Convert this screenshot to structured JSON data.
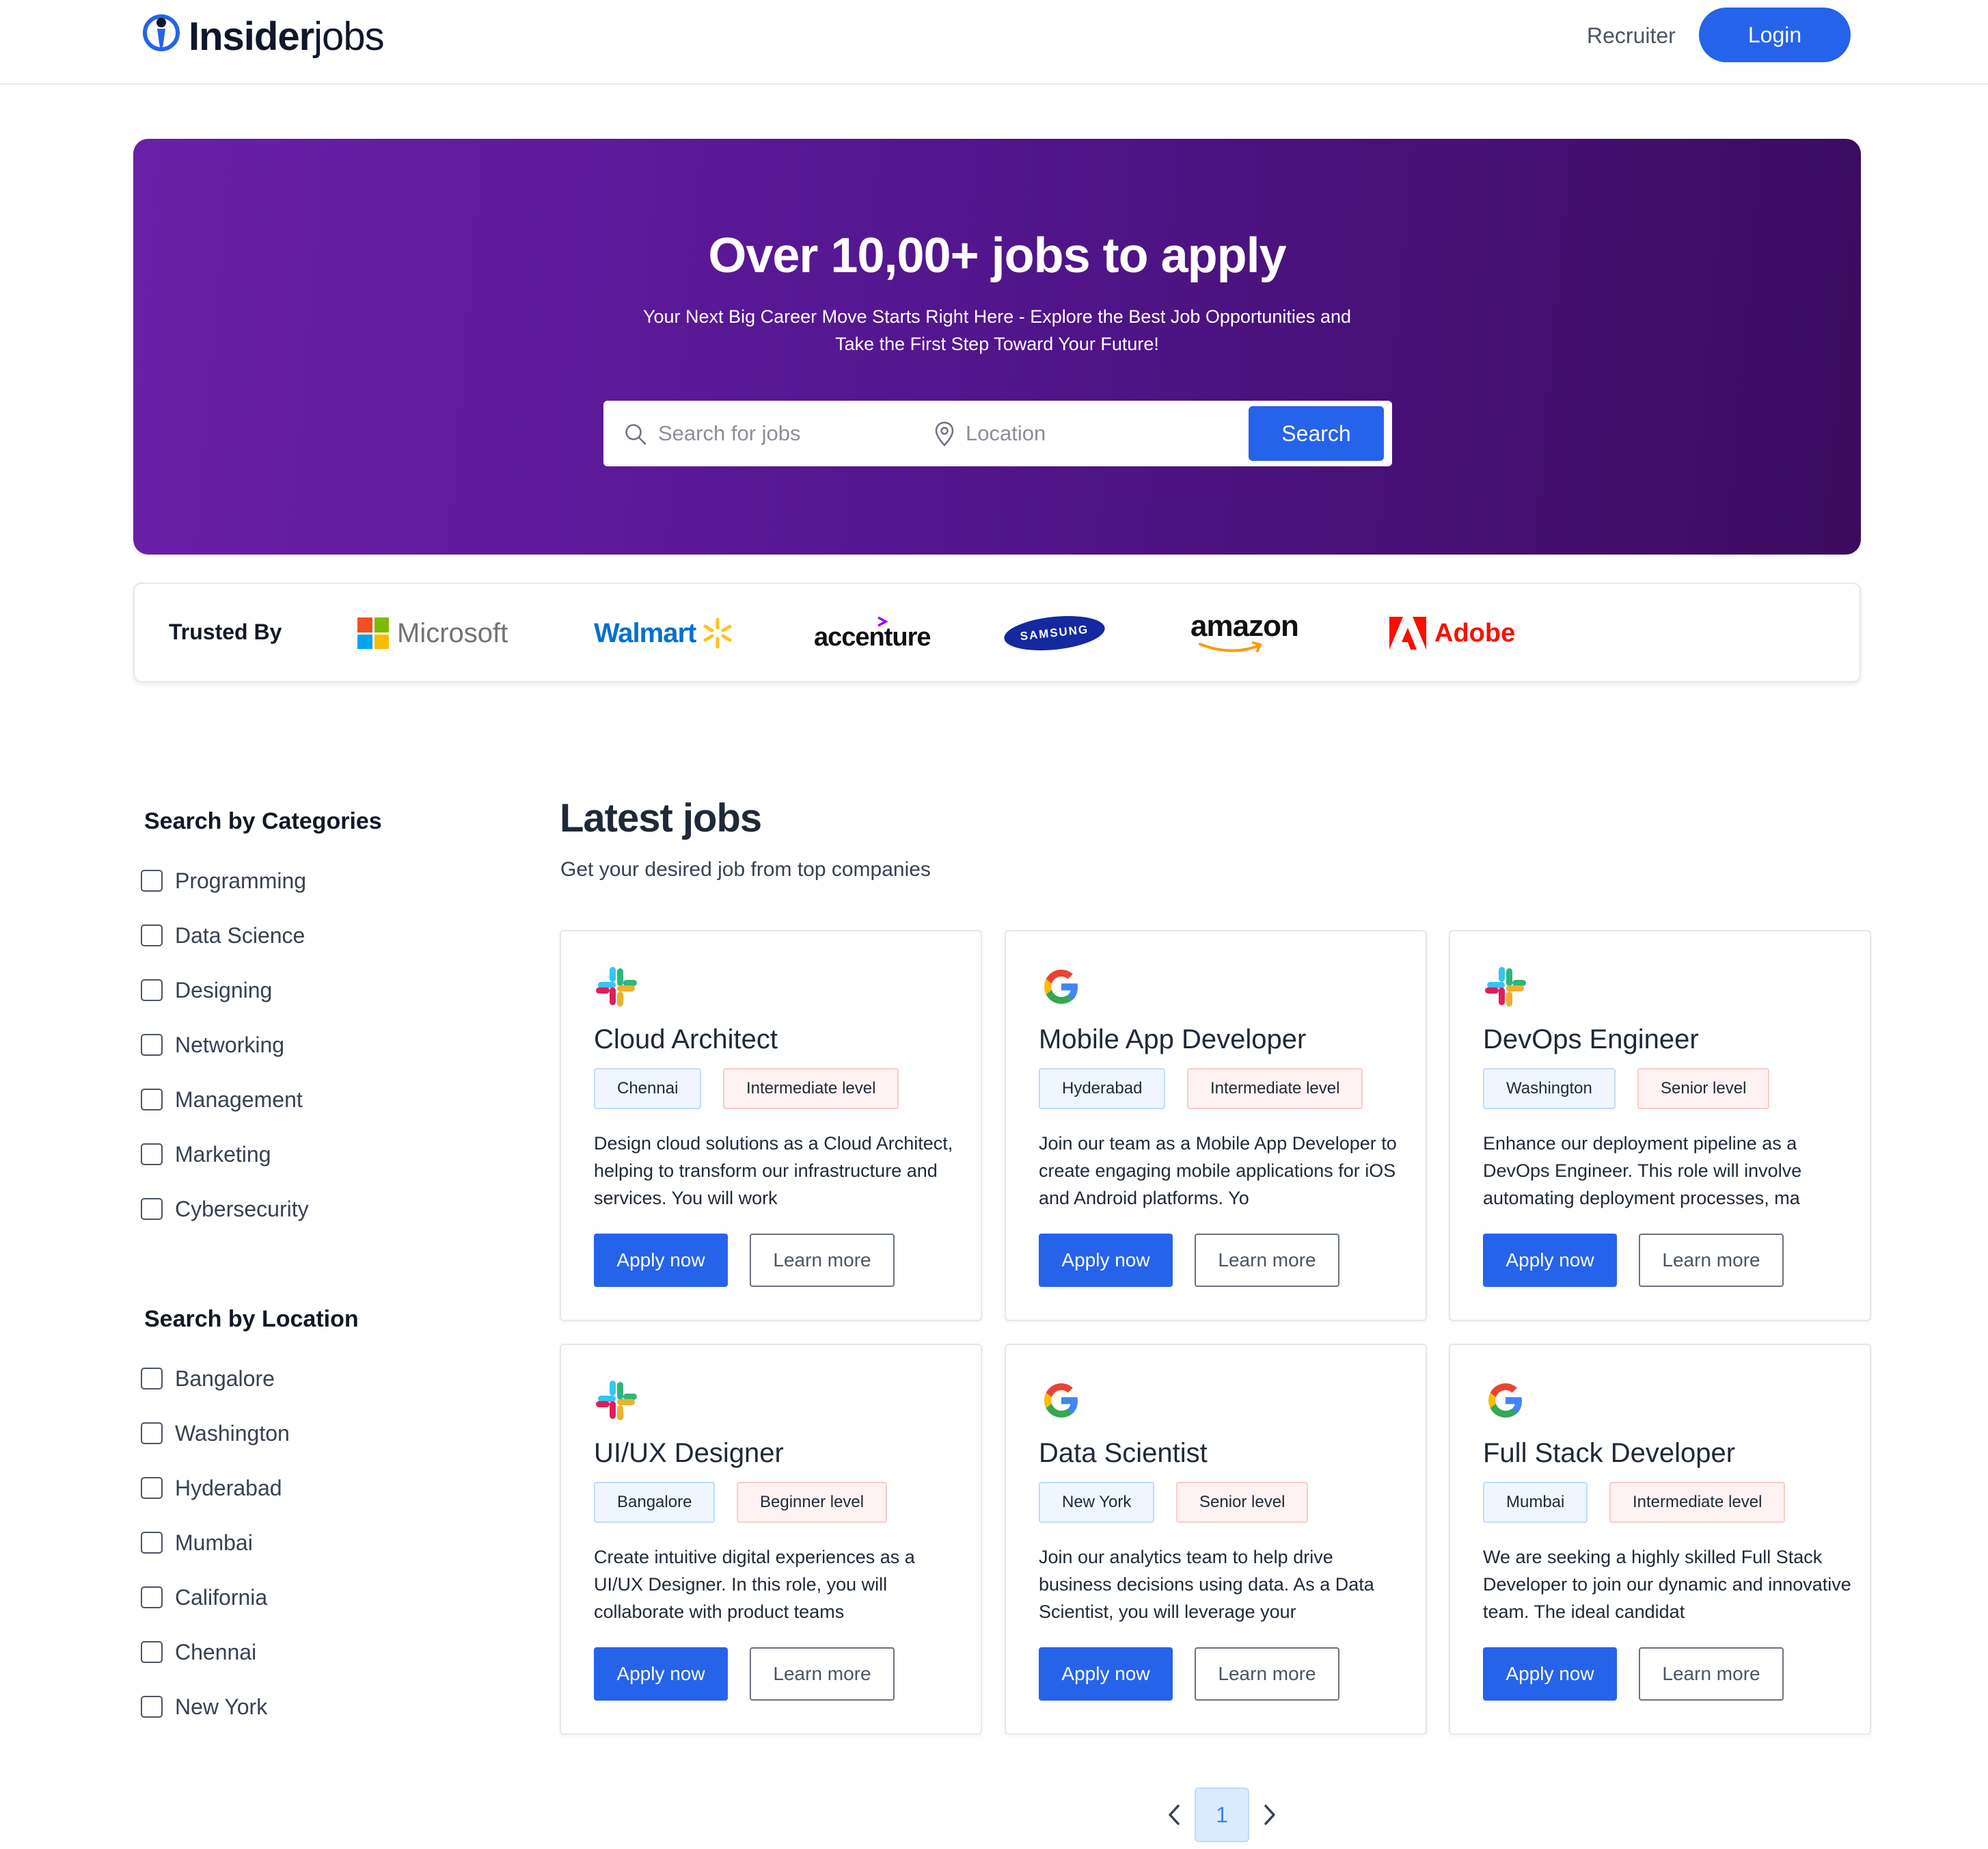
{
  "header": {
    "logo_bold": "Insider",
    "logo_light": "jobs",
    "recruiter_label": "Recruiter",
    "login_label": "Login",
    "accent_color": "#2563eb"
  },
  "hero": {
    "title": "Over 10,00+ jobs to apply",
    "subtitle": "Your Next Big Career Move Starts Right Here - Explore the Best Job Opportunities and Take the First Step Toward Your Future!",
    "search_placeholder": "Search for jobs",
    "location_placeholder": "Location",
    "search_button": "Search",
    "gradient_start": "#6a1fa8",
    "gradient_end": "#3b0b5f"
  },
  "trusted": {
    "label": "Trusted By",
    "brands": {
      "microsoft": "Microsoft",
      "walmart": "Walmart",
      "accenture": "accenture",
      "samsung": "SAMSUNG",
      "amazon": "amazon",
      "adobe": "Adobe"
    }
  },
  "sidebar": {
    "categories_title": "Search by Categories",
    "categories": [
      "Programming",
      "Data Science",
      "Designing",
      "Networking",
      "Management",
      "Marketing",
      "Cybersecurity"
    ],
    "location_title": "Search by Location",
    "locations": [
      "Bangalore",
      "Washington",
      "Hyderabad",
      "Mumbai",
      "California",
      "Chennai",
      "New York"
    ]
  },
  "jobs_section": {
    "title": "Latest jobs",
    "subtitle": "Get your desired job from top companies",
    "apply_label": "Apply now",
    "learn_label": "Learn more",
    "jobs": [
      {
        "company_icon": "slack-icon",
        "title": "Cloud Architect",
        "location": "Chennai",
        "level": "Intermediate level",
        "description": "Design cloud solutions as a Cloud Architect, helping to transform our infrastructure and services. You will work"
      },
      {
        "company_icon": "google-icon",
        "title": "Mobile App Developer",
        "location": "Hyderabad",
        "level": "Intermediate level",
        "description": "Join our team as a Mobile App Developer to create engaging mobile applications for iOS and Android platforms. Yo"
      },
      {
        "company_icon": "slack-icon",
        "title": "DevOps Engineer",
        "location": "Washington",
        "level": "Senior level",
        "description": "Enhance our deployment pipeline as a DevOps Engineer. This role will involve automating deployment processes, ma"
      },
      {
        "company_icon": "slack-icon",
        "title": "UI/UX Designer",
        "location": "Bangalore",
        "level": "Beginner level",
        "description": "Create intuitive digital experiences as a UI/UX Designer. In this role, you will collaborate with product teams"
      },
      {
        "company_icon": "google-icon",
        "title": "Data Scientist",
        "location": "New York",
        "level": "Senior level",
        "description": "Join our analytics team to help drive business decisions using data. As a Data Scientist, you will leverage your"
      },
      {
        "company_icon": "google-icon",
        "title": "Full Stack Developer",
        "location": "Mumbai",
        "level": "Intermediate level",
        "description": "We are seeking a highly skilled Full Stack Developer to join our dynamic and innovative team. The ideal candidat"
      }
    ]
  },
  "pagination": {
    "current_page": "1"
  }
}
